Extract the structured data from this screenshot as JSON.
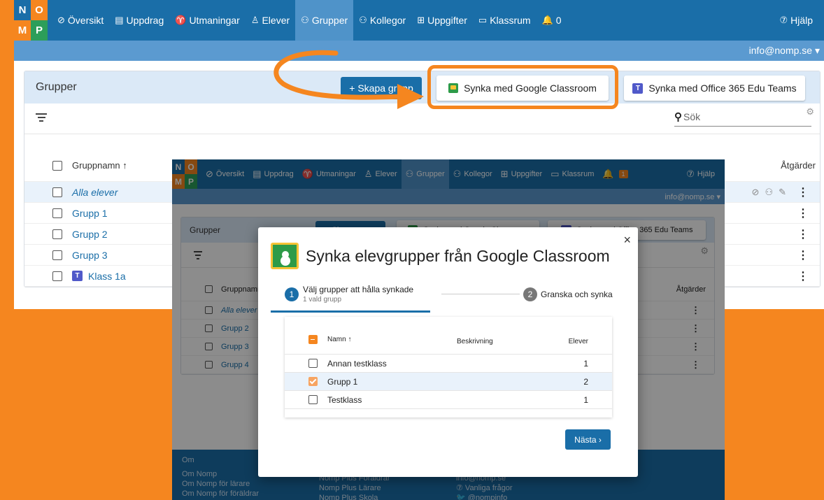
{
  "logo": {
    "letters": [
      "N",
      "O",
      "M",
      "P"
    ]
  },
  "nav": [
    {
      "icon": "⊘",
      "label": "Översikt"
    },
    {
      "icon": "▤",
      "label": "Uppdrag"
    },
    {
      "icon": "♈",
      "label": "Utmaningar"
    },
    {
      "icon": "♙",
      "label": "Elever"
    },
    {
      "icon": "⚇",
      "label": "Grupper"
    },
    {
      "icon": "⚇",
      "label": "Kollegor"
    },
    {
      "icon": "⊞",
      "label": "Uppgifter"
    },
    {
      "icon": "▭",
      "label": "Klassrum"
    },
    {
      "icon": "🔔",
      "label": "0"
    }
  ],
  "help": "Hjälp",
  "user": "info@nomp.se ▾",
  "page": {
    "title": "Grupper",
    "create": "+ Skapa grupp",
    "sync_google": "Synka med Google Classroom",
    "sync_office": "Synka med Office 365 Edu Teams",
    "search": "Sök"
  },
  "table": {
    "col_name": "Gruppnamn ↑",
    "col_actions": "Åtgärder",
    "rows": [
      "Alla elever",
      "Grupp 1",
      "Grupp 2",
      "Grupp 3",
      "Klass 1a"
    ]
  },
  "front": {
    "bell_count": "1",
    "rows": [
      "Alla elever",
      "Grupp 2",
      "Grupp 3",
      "Grupp 4"
    ],
    "col_name": "Gruppnamn",
    "footer": {
      "col1": [
        "Om",
        "Om Nomp",
        "Om Nomp för lärare",
        "Om Nomp för föräldrar"
      ],
      "col2": [
        "Nomp Plus Föräldrar",
        "Nomp Plus Lärare",
        "Nomp Plus Skola"
      ],
      "col3": [
        "info@nomp.se",
        "⑦ Vanliga frågor",
        "@nompinfo"
      ]
    }
  },
  "dialog": {
    "title": "Synka elevgrupper från Google Classroom",
    "close": "×",
    "step1": {
      "num": "1",
      "label": "Välj grupper att hålla synkade",
      "sub": "1 vald grupp"
    },
    "step2": {
      "num": "2",
      "label": "Granska och synka"
    },
    "headers": {
      "name": "Namn ↑",
      "desc": "Beskrivning",
      "students": "Elever"
    },
    "rows": [
      {
        "name": "Annan testklass",
        "students": "1",
        "checked": false
      },
      {
        "name": "Grupp 1",
        "students": "2",
        "checked": true
      },
      {
        "name": "Testklass",
        "students": "1",
        "checked": false
      }
    ],
    "next": "Nästa ›"
  },
  "colors": {
    "accent": "#1a6ea8",
    "orange": "#f5861f",
    "google_green": "#2e9b48",
    "teams_purple": "#5059c9"
  }
}
